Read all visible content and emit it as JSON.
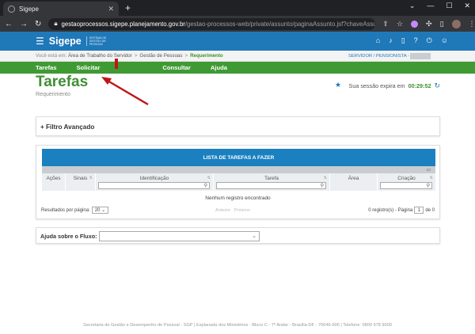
{
  "browser": {
    "tab_title": "Sigepe",
    "new_tab": "+",
    "url_domain": "gestaoprocessos.sigepe.planejamento.gov.br",
    "url_path": "/gestao-processos-web/private/assunto/paginaAssunto.jsf?chaveAssunto=requ..."
  },
  "header": {
    "logo": "Sigepe",
    "logo_sub": "SISTEMA DE GESTÃO DE PESSOAS"
  },
  "breadcrumb": {
    "prefix": "Você está em:",
    "items": [
      "Área de Trabalho do Servidor",
      "Gestão de Pessoas",
      "Requerimento"
    ],
    "separator": ">",
    "user": "SERVIDOR / PENSIONISTA - DPF"
  },
  "menu": {
    "items": [
      "Tarefas",
      "Solicitar",
      "Consultar",
      "Ajuda"
    ]
  },
  "page": {
    "title": "Tarefas",
    "subtitle": "Requerimento",
    "session_label": "Sua sessão expira em",
    "session_time": "00:29:52"
  },
  "filter": {
    "label": "+ Filtro Avançado"
  },
  "table": {
    "title": "LISTA DE TAREFAS A FAZER",
    "columns": [
      "Ações",
      "Sinais",
      "Identificação",
      "Tarefa",
      "Área",
      "Criação"
    ],
    "empty": "Nenhum registro encontrado",
    "per_page_label": "Resultados por página:",
    "per_page_value": "20",
    "prev": "Anterior",
    "next": "Próximo",
    "records": "0 registro(s) - Página",
    "page": "1",
    "of": "de 0"
  },
  "flux": {
    "label": "Ajuda sobre o Fluxo:"
  },
  "footer": {
    "text": "Secretaria de Gestão e Desempenho de Pessoal - SGP | Esplanada dos Ministérios - Bloco C - 7º Andar - Brasília-DF - 70046-900 | Telefone: 0800 978 9009"
  },
  "colors": {
    "header": "#1f78b8",
    "menu": "#3f9a34",
    "highlight": "#c01515"
  }
}
